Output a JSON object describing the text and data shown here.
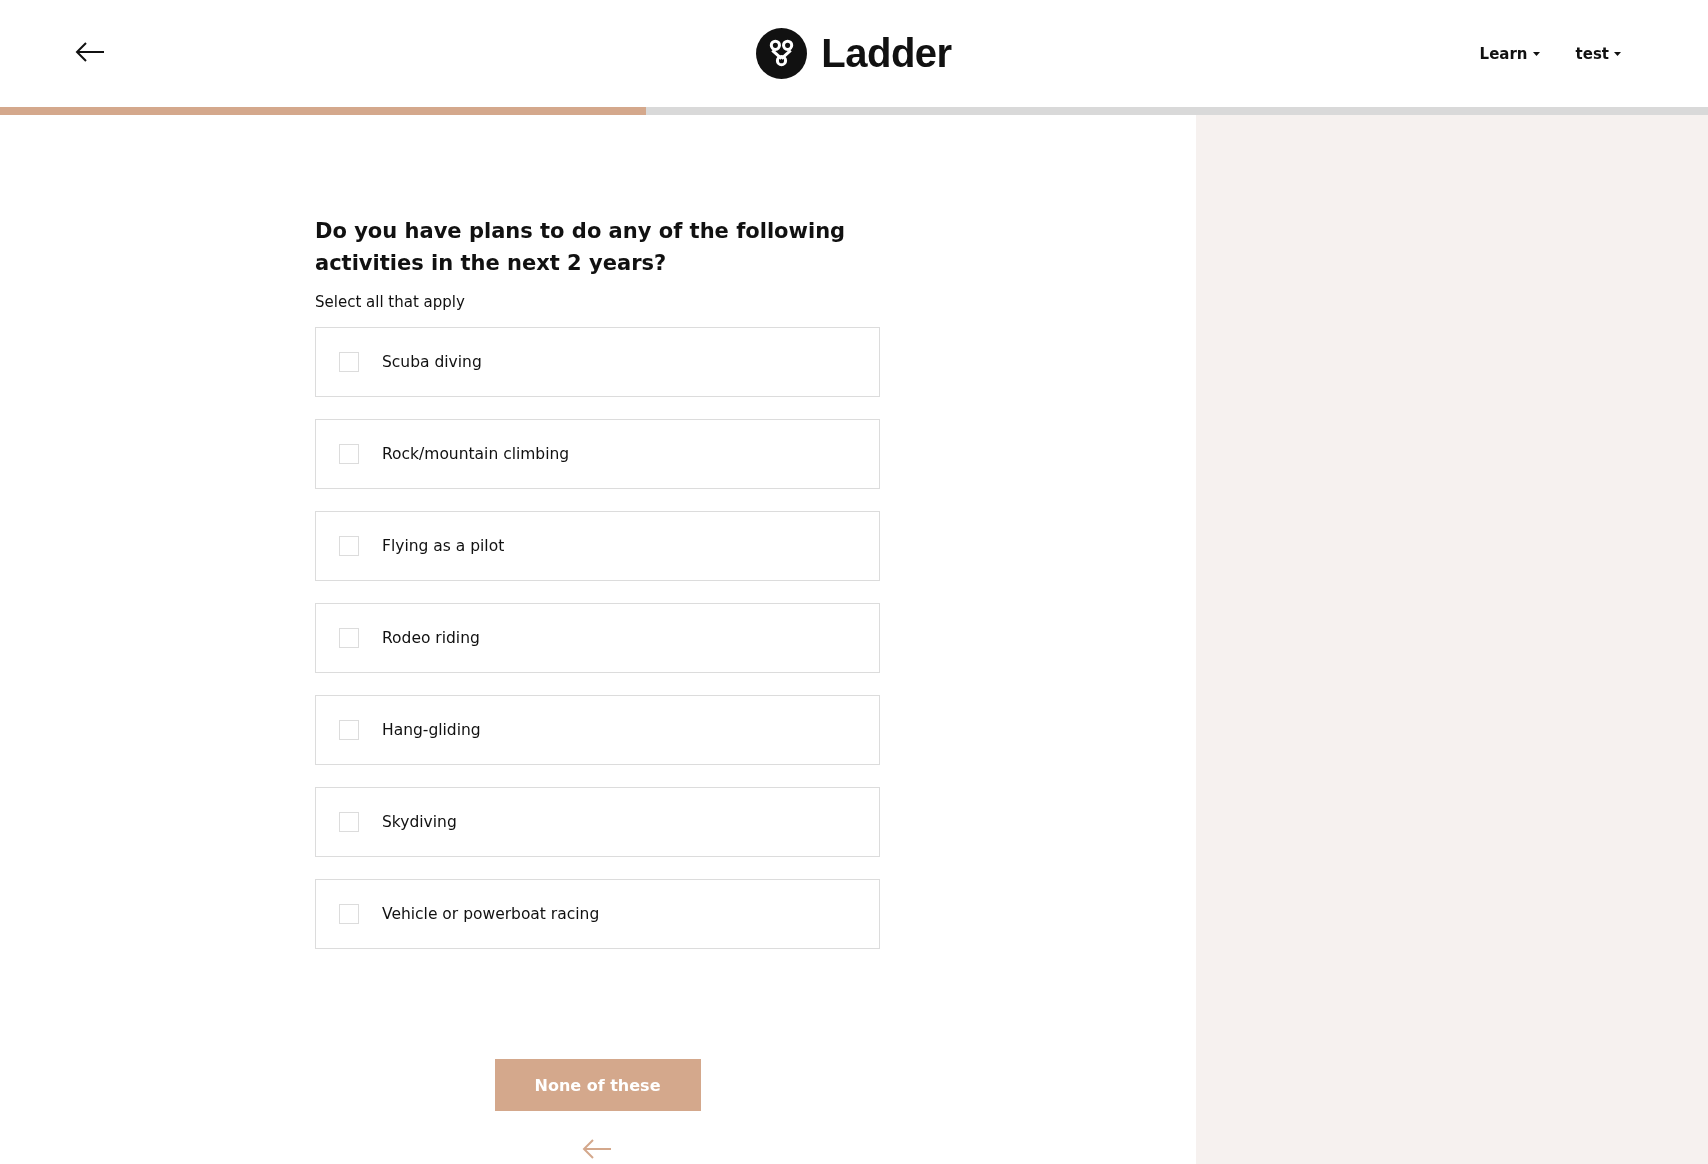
{
  "header": {
    "brand": "Ladder",
    "nav": [
      {
        "label": "Learn"
      },
      {
        "label": "test"
      }
    ]
  },
  "progress": {
    "level": 0.378
  },
  "question": {
    "title": "Do you have plans to do any of the following activities in the next 2 years?",
    "hint": "Select all that apply",
    "options": [
      {
        "label": "Scuba diving",
        "checked": false
      },
      {
        "label": "Rock/mountain climbing",
        "checked": false
      },
      {
        "label": "Flying as a pilot",
        "checked": false
      },
      {
        "label": "Rodeo riding",
        "checked": false
      },
      {
        "label": "Hang-gliding",
        "checked": false
      },
      {
        "label": "Skydiving",
        "checked": false
      },
      {
        "label": "Vehicle or powerboat racing",
        "checked": false
      }
    ],
    "none_button": "None of these"
  }
}
